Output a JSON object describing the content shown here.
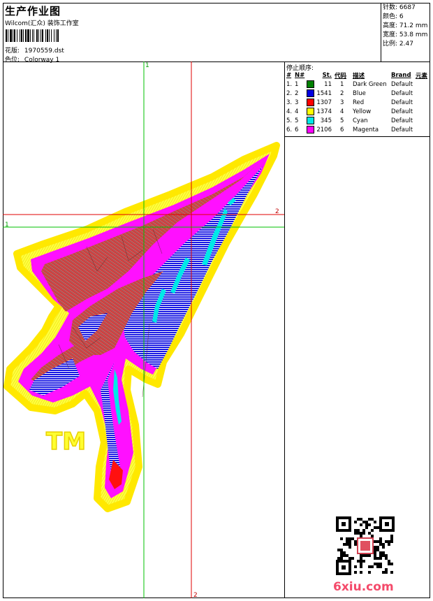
{
  "header": {
    "title": "生产作业图",
    "subtitle": "Wilcom(汇众) 装饰工作室",
    "design_label": "花版:",
    "design_value": "1970559.dst",
    "colorway_label": "色位:",
    "colorway_value": "Colorway 1"
  },
  "stats": [
    {
      "label": "针数:",
      "value": "6687"
    },
    {
      "label": "颜色:",
      "value": "6"
    },
    {
      "label": "高度:",
      "value": "71.2 mm"
    },
    {
      "label": "宽度:",
      "value": "53.8 mm"
    },
    {
      "label": "比例:",
      "value": "2.47"
    }
  ],
  "stop_sequence": {
    "title": "停止顺序:",
    "headers": [
      "#",
      "N#",
      "St.",
      "代码",
      "描述",
      "Brand",
      "元素"
    ],
    "rows": [
      {
        "num": "1.",
        "n": "1",
        "color": "#008000",
        "st": "11",
        "code": "1",
        "desc": "Dark Green",
        "brand": "Default"
      },
      {
        "num": "2.",
        "n": "2",
        "color": "#0000e0",
        "st": "1541",
        "code": "2",
        "desc": "Blue",
        "brand": "Default"
      },
      {
        "num": "3.",
        "n": "3",
        "color": "#ff0000",
        "st": "1307",
        "code": "3",
        "desc": "Red",
        "brand": "Default"
      },
      {
        "num": "4.",
        "n": "4",
        "color": "#ffff00",
        "st": "1374",
        "code": "4",
        "desc": "Yellow",
        "brand": "Default"
      },
      {
        "num": "5.",
        "n": "5",
        "color": "#00e8e8",
        "st": "345",
        "code": "5",
        "desc": "Cyan",
        "brand": "Default"
      },
      {
        "num": "6.",
        "n": "6",
        "color": "#ff00ff",
        "st": "2106",
        "code": "6",
        "desc": "Magenta",
        "brand": "Default"
      }
    ]
  },
  "guides": {
    "v1": "1",
    "h1": "1",
    "v2": "2",
    "h2": "2"
  },
  "design_text": "TM",
  "watermark": "6xiu.com",
  "colors": {
    "green_guide": "#00c000",
    "red_guide": "#e00000",
    "watermark": "#f44a6a"
  }
}
